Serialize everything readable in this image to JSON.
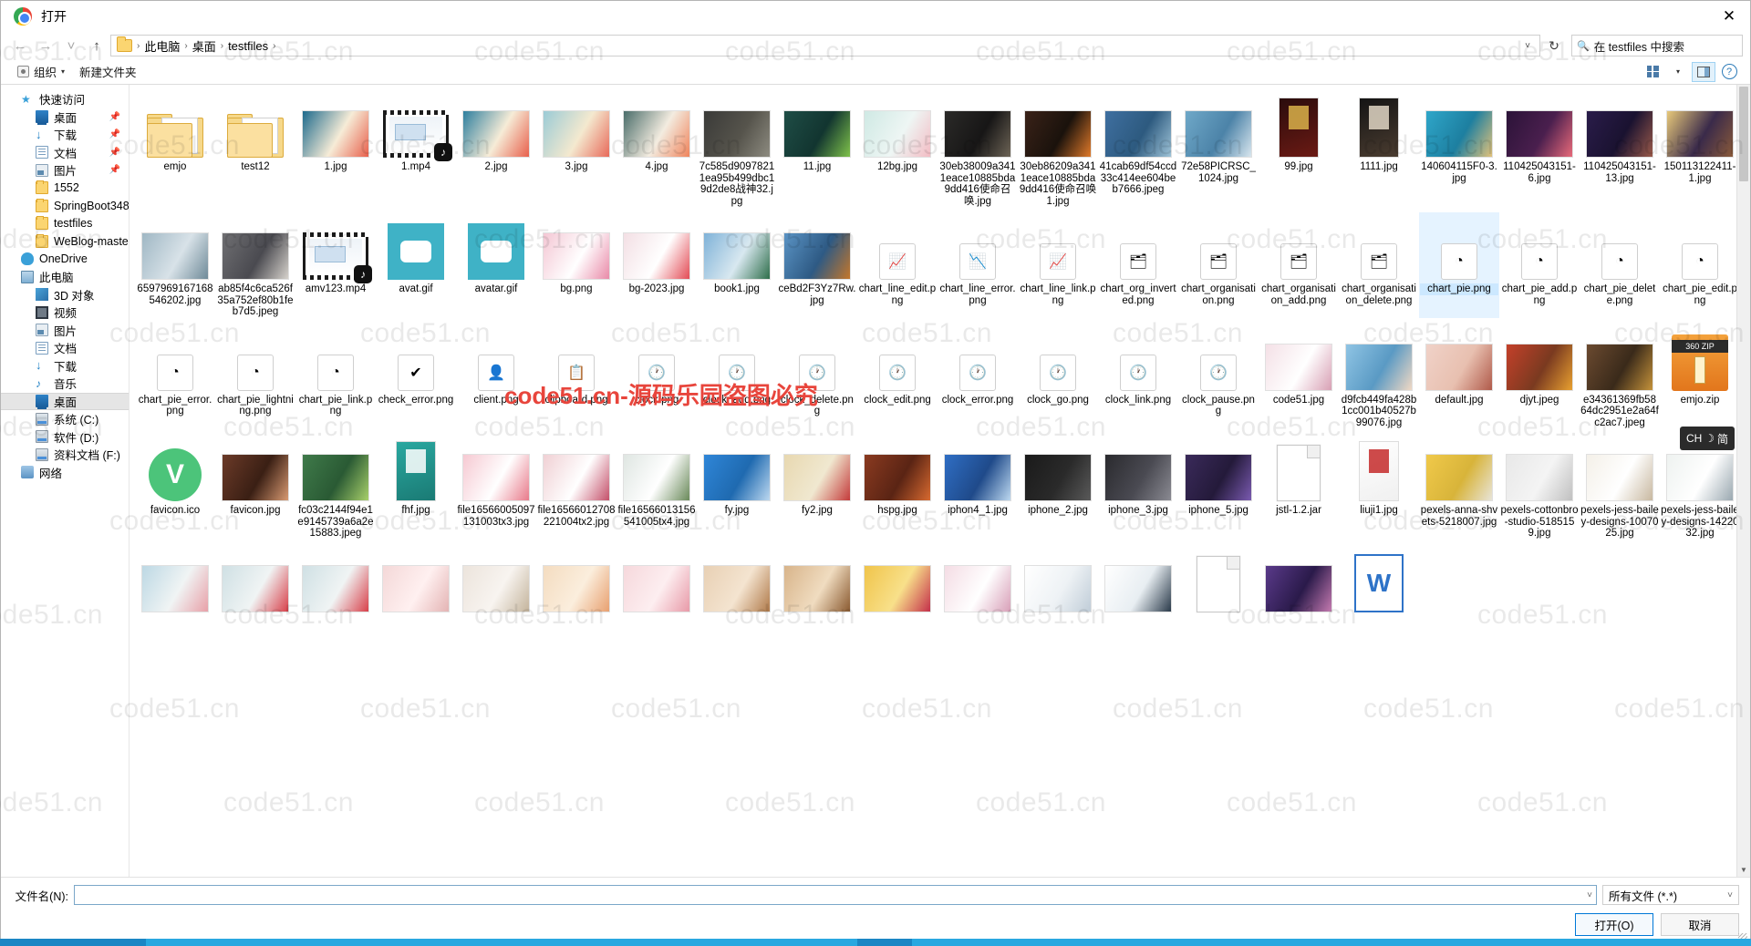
{
  "window": {
    "title": "打开",
    "close_label": "✕",
    "app_icon": "chrome-icon"
  },
  "address": {
    "back": "←",
    "forward": "→",
    "recent": "˅",
    "up": "↑",
    "crumbs": [
      "此电脑",
      "桌面",
      "testfiles"
    ],
    "separator": "›",
    "dropdown_caret": "˅",
    "refresh": "↻",
    "search_icon": "search-icon",
    "search_value": "在 testfiles 中搜索"
  },
  "commandbar": {
    "organize": "组织",
    "organize_caret": "▾",
    "new_folder": "新建文件夹",
    "view_icon": "view-layout-icon",
    "view_caret": "▾",
    "pane_icon": "preview-pane-icon",
    "help": "?"
  },
  "sidebar": {
    "items": [
      {
        "label": "快速访问",
        "icon": "star-icon",
        "level": 0,
        "pinned": false,
        "selected": false
      },
      {
        "label": "桌面",
        "icon": "desktop-icon",
        "level": 1,
        "pinned": true,
        "selected": false
      },
      {
        "label": "下载",
        "icon": "download-icon",
        "level": 1,
        "pinned": true,
        "selected": false
      },
      {
        "label": "文档",
        "icon": "documents-icon",
        "level": 1,
        "pinned": true,
        "selected": false
      },
      {
        "label": "图片",
        "icon": "pictures-icon",
        "level": 1,
        "pinned": true,
        "selected": false
      },
      {
        "label": "1552",
        "icon": "folder-icon",
        "level": 1,
        "pinned": false,
        "selected": false
      },
      {
        "label": "SpringBoot348",
        "icon": "folder-icon",
        "level": 1,
        "pinned": false,
        "selected": false
      },
      {
        "label": "testfiles",
        "icon": "folder-icon",
        "level": 1,
        "pinned": false,
        "selected": false
      },
      {
        "label": "WeBlog-master",
        "icon": "folder-icon",
        "level": 1,
        "pinned": false,
        "selected": false
      },
      {
        "label": "OneDrive",
        "icon": "cloud-icon",
        "level": 0,
        "pinned": false,
        "selected": false
      },
      {
        "label": "此电脑",
        "icon": "computer-icon",
        "level": 0,
        "pinned": false,
        "selected": false
      },
      {
        "label": "3D 对象",
        "icon": "3d-objects-icon",
        "level": 1,
        "pinned": false,
        "selected": false
      },
      {
        "label": "视频",
        "icon": "videos-icon",
        "level": 1,
        "pinned": false,
        "selected": false
      },
      {
        "label": "图片",
        "icon": "pictures-icon",
        "level": 1,
        "pinned": false,
        "selected": false
      },
      {
        "label": "文档",
        "icon": "documents-icon",
        "level": 1,
        "pinned": false,
        "selected": false
      },
      {
        "label": "下载",
        "icon": "download-icon",
        "level": 1,
        "pinned": false,
        "selected": false
      },
      {
        "label": "音乐",
        "icon": "music-icon",
        "level": 1,
        "pinned": false,
        "selected": false
      },
      {
        "label": "桌面",
        "icon": "desktop-icon",
        "level": 1,
        "pinned": false,
        "selected": true
      },
      {
        "label": "系统 (C:)",
        "icon": "drive-icon",
        "level": 1,
        "pinned": false,
        "selected": false
      },
      {
        "label": "软件 (D:)",
        "icon": "drive-icon",
        "level": 1,
        "pinned": false,
        "selected": false
      },
      {
        "label": "资料文档 (F:)",
        "icon": "drive-icon",
        "level": 1,
        "pinned": false,
        "selected": false
      },
      {
        "label": "网络",
        "icon": "network-icon",
        "level": 0,
        "pinned": false,
        "selected": false
      }
    ]
  },
  "files": [
    {
      "name": "emjo",
      "kind": "folder"
    },
    {
      "name": "test12",
      "kind": "folder"
    },
    {
      "name": "1.jpg",
      "kind": "image",
      "c1": "#1d6a8c",
      "c2": "#e8604c",
      "c3": "#f6ecd7"
    },
    {
      "name": "1.mp4",
      "kind": "video"
    },
    {
      "name": "2.jpg",
      "kind": "image",
      "c1": "#2e7f9e",
      "c2": "#e8604c",
      "c3": "#f6ecd7"
    },
    {
      "name": "3.jpg",
      "kind": "image",
      "c1": "#9bcbd6",
      "c2": "#e86a5a",
      "c3": "#f4e9cf"
    },
    {
      "name": "4.jpg",
      "kind": "image",
      "c1": "#4a6d6a",
      "c2": "#f0845c",
      "c3": "#f3ece0"
    },
    {
      "name": "7c585d90978211ea95b499dbc19d2de8战神32.jpg",
      "kind": "photo",
      "c1": "#3a3a38",
      "c2": "#8d8b80",
      "c3": "#56544c"
    },
    {
      "name": "11.jpg",
      "kind": "photo",
      "c1": "#1f4d46",
      "c2": "#7fc24a",
      "c3": "#123530"
    },
    {
      "name": "12bg.jpg",
      "kind": "image",
      "c1": "#cfe9e4",
      "c2": "#f3bcc4",
      "c3": "#eef6f4"
    },
    {
      "name": "30eb38009a3411eace10885bda9dd416使命召唤.jpg",
      "kind": "photo",
      "c1": "#2b2a28",
      "c2": "#6d6456",
      "c3": "#171616"
    },
    {
      "name": "30eb86209a3411eace10885bda9dd416使命召唤1.jpg",
      "kind": "photo",
      "c1": "#3a2218",
      "c2": "#e07a2a",
      "c3": "#1a120c"
    },
    {
      "name": "41cab69df54ccd33c414ee604beb7666.jpeg",
      "kind": "photo",
      "c1": "#3f6fa0",
      "c2": "#9fc4d8",
      "c3": "#2d5a7f"
    },
    {
      "name": "72e58PICRSC_1024.jpg",
      "kind": "photo",
      "c1": "#6fa8c8",
      "c2": "#d8e6ee",
      "c3": "#4c83a8"
    },
    {
      "name": "99.jpg",
      "kind": "poster",
      "c1": "#2a0c0c",
      "c2": "#d9b24a",
      "c3": "#6b1a14"
    },
    {
      "name": "1111.jpg",
      "kind": "poster",
      "c1": "#141414",
      "c2": "#e0d6c4",
      "c3": "#4a3c30"
    },
    {
      "name": "140604115F0-3.jpg",
      "kind": "photo",
      "c1": "#2fa6c9",
      "c2": "#e2c27a",
      "c3": "#1d7fa0"
    },
    {
      "name": "110425043151-6.jpg",
      "kind": "photo",
      "c1": "#2b1338",
      "c2": "#e86a7a",
      "c3": "#4a1f4e"
    },
    {
      "name": "110425043151-13.jpg",
      "kind": "photo",
      "c1": "#2a1c4a",
      "c2": "#9a5a4a",
      "c3": "#1a1230"
    },
    {
      "name": "150113122411-1.jpg",
      "kind": "photo",
      "c1": "#e8c97a",
      "c2": "#8a5a3a",
      "c3": "#3a2a4a"
    },
    {
      "name": "6597969167168546202.jpg",
      "kind": "photo",
      "c1": "#9fb7c4",
      "c2": "#6f8a98",
      "c3": "#d8e2e8"
    },
    {
      "name": "ab85f4c6ca526f35a752ef80b1feb7d5.jpeg",
      "kind": "photo",
      "c1": "#6f6f72",
      "c2": "#d6d2cc",
      "c3": "#4a4a50"
    },
    {
      "name": "amv123.mp4",
      "kind": "video"
    },
    {
      "name": "avat.gif",
      "kind": "avatar",
      "c1": "#3fb2c6",
      "c2": "#ffffff",
      "c3": "#2a8fa0"
    },
    {
      "name": "avatar.gif",
      "kind": "avatar",
      "c1": "#3fb2c6",
      "c2": "#ffffff",
      "c3": "#2a8fa0"
    },
    {
      "name": "bg.png",
      "kind": "image",
      "c1": "#f4c7d4",
      "c2": "#e98aa8",
      "c3": "#ffffff"
    },
    {
      "name": "bg-2023.jpg",
      "kind": "image",
      "c1": "#f3dfe4",
      "c2": "#e34b55",
      "c3": "#ffffff"
    },
    {
      "name": "book1.jpg",
      "kind": "photo",
      "c1": "#7fb2d8",
      "c2": "#2e6e4a",
      "c3": "#d8e8f0"
    },
    {
      "name": "ceBd2F3Yz7Rw.jpg",
      "kind": "photo",
      "c1": "#5a93c4",
      "c2": "#c4762a",
      "c3": "#2e5a84"
    },
    {
      "name": "chart_line_edit.png",
      "kind": "pngicon",
      "glyph": "📈"
    },
    {
      "name": "chart_line_error.png",
      "kind": "pngicon",
      "glyph": "📉"
    },
    {
      "name": "chart_line_link.png",
      "kind": "pngicon",
      "glyph": "📈"
    },
    {
      "name": "chart_org_inverted.png",
      "kind": "pngicon",
      "glyph": "🗂"
    },
    {
      "name": "chart_organisation.png",
      "kind": "pngicon",
      "glyph": "🗂"
    },
    {
      "name": "chart_organisation_add.png",
      "kind": "pngicon",
      "glyph": "🗂"
    },
    {
      "name": "chart_organisation_delete.png",
      "kind": "pngicon",
      "glyph": "🗂"
    },
    {
      "name": "chart_pie.png",
      "kind": "pngicon",
      "glyph": "◔",
      "selected": true
    },
    {
      "name": "chart_pie_add.png",
      "kind": "pngicon",
      "glyph": "◔"
    },
    {
      "name": "chart_pie_delete.png",
      "kind": "pngicon",
      "glyph": "◔"
    },
    {
      "name": "chart_pie_edit.png",
      "kind": "pngicon",
      "glyph": "◔"
    },
    {
      "name": "chart_pie_error.png",
      "kind": "pngicon",
      "glyph": "◔"
    },
    {
      "name": "chart_pie_lightning.png",
      "kind": "pngicon",
      "glyph": "◔"
    },
    {
      "name": "chart_pie_link.png",
      "kind": "pngicon",
      "glyph": "◔"
    },
    {
      "name": "check_error.png",
      "kind": "pngicon",
      "glyph": "✔"
    },
    {
      "name": "client.png",
      "kind": "pngicon",
      "glyph": "👤"
    },
    {
      "name": "clipboard.png",
      "kind": "pngicon",
      "glyph": "📋"
    },
    {
      "name": "clock.png",
      "kind": "pngicon",
      "glyph": "🕐"
    },
    {
      "name": "clock_add.png",
      "kind": "pngicon",
      "glyph": "🕐"
    },
    {
      "name": "clock_delete.png",
      "kind": "pngicon",
      "glyph": "🕐"
    },
    {
      "name": "clock_edit.png",
      "kind": "pngicon",
      "glyph": "🕐"
    },
    {
      "name": "clock_error.png",
      "kind": "pngicon",
      "glyph": "🕐"
    },
    {
      "name": "clock_go.png",
      "kind": "pngicon",
      "glyph": "🕐"
    },
    {
      "name": "clock_link.png",
      "kind": "pngicon",
      "glyph": "🕐"
    },
    {
      "name": "clock_pause.png",
      "kind": "pngicon",
      "glyph": "🕐"
    },
    {
      "name": "code51.jpg",
      "kind": "photo",
      "c1": "#f4e0e6",
      "c2": "#d8a0b4",
      "c3": "#ffffff"
    },
    {
      "name": "d9fcb449fa428b1cc001b40527b99076.jpg",
      "kind": "photo",
      "c1": "#8fc4e4",
      "c2": "#f0d8c4",
      "c3": "#5a9ac4"
    },
    {
      "name": "default.jpg",
      "kind": "photo",
      "c1": "#f0d2c8",
      "c2": "#b05a4a",
      "c3": "#e8c0b0"
    },
    {
      "name": "djyt.jpeg",
      "kind": "photo",
      "c1": "#c4402a",
      "c2": "#e8a030",
      "c3": "#7a3a20"
    },
    {
      "name": "e34361369fb5864dc2951e2a64fc2ac7.jpeg",
      "kind": "photo",
      "c1": "#6b4a30",
      "c2": "#c4923a",
      "c3": "#3a2a1a"
    },
    {
      "name": "emjo.zip",
      "kind": "zip"
    },
    {
      "name": "favicon.ico",
      "kind": "favicon"
    },
    {
      "name": "favicon.jpg",
      "kind": "photo",
      "c1": "#6b3a28",
      "c2": "#d89a72",
      "c3": "#3a1f14"
    },
    {
      "name": "fc03c2144f94e1e9145739a6a2e15883.jpeg",
      "kind": "photo",
      "c1": "#3f7a4a",
      "c2": "#a8d06a",
      "c3": "#2a5a34"
    },
    {
      "name": "fhf.jpg",
      "kind": "poster",
      "c1": "#2aa8a0",
      "c2": "#ffffff",
      "c3": "#1a7a74"
    },
    {
      "name": "file16566005097131003tx3.jpg",
      "kind": "photo",
      "c1": "#f6c9d2",
      "c2": "#e87a8a",
      "c3": "#ffffff"
    },
    {
      "name": "file16566012708221004tx2.jpg",
      "kind": "photo",
      "c1": "#f0d0d4",
      "c2": "#c4506a",
      "c3": "#ffffff"
    },
    {
      "name": "file16566013156541005tx4.jpg",
      "kind": "photo",
      "c1": "#dfe6e2",
      "c2": "#6a8a5a",
      "c3": "#ffffff"
    },
    {
      "name": "fy.jpg",
      "kind": "photo",
      "c1": "#2f86d8",
      "c2": "#bcd8f0",
      "c3": "#1f6ab0"
    },
    {
      "name": "fy2.jpg",
      "kind": "photo",
      "c1": "#e8d8b0",
      "c2": "#c43a3a",
      "c3": "#f0e8d0"
    },
    {
      "name": "hspg.jpg",
      "kind": "photo",
      "c1": "#8a3a20",
      "c2": "#d86a30",
      "c3": "#5a2414"
    },
    {
      "name": "iphon4_1.jpg",
      "kind": "photo",
      "c1": "#2f6ec4",
      "c2": "#bcd8f0",
      "c3": "#1f4a8a"
    },
    {
      "name": "iphone_2.jpg",
      "kind": "photo",
      "c1": "#1a1a1a",
      "c2": "#5a5a5a",
      "c3": "#2a2a2a"
    },
    {
      "name": "iphone_3.jpg",
      "kind": "photo",
      "c1": "#2a2a2e",
      "c2": "#8a8a92",
      "c3": "#4a4a52"
    },
    {
      "name": "iphone_5.jpg",
      "kind": "photo",
      "c1": "#3a2a5a",
      "c2": "#7a5ab0",
      "c3": "#241a3a"
    },
    {
      "name": "jstl-1.2.jar",
      "kind": "doc"
    },
    {
      "name": "liuji1.jpg",
      "kind": "poster",
      "c1": "#ffffff",
      "c2": "#c42a2a",
      "c3": "#f0f0f0"
    },
    {
      "name": "pexels-anna-shvets-5218007.jpg",
      "kind": "photo",
      "c1": "#f0c94a",
      "c2": "#e8e4d8",
      "c3": "#d8b43a"
    },
    {
      "name": "pexels-cottonbro-studio-5185159.jpg",
      "kind": "photo",
      "c1": "#e8e8e8",
      "c2": "#c0c0c0",
      "c3": "#f4f4f4"
    },
    {
      "name": "pexels-jess-bailey-designs-1007025.jpg",
      "kind": "photo",
      "c1": "#f4f0e8",
      "c2": "#c8b8a0",
      "c3": "#ffffff"
    },
    {
      "name": "pexels-jess-bailey-designs-1422032.jpg",
      "kind": "photo",
      "c1": "#eef2f0",
      "c2": "#9aa8b0",
      "c3": "#ffffff"
    },
    {
      "name": "",
      "kind": "photo",
      "c1": "#bcd8e4",
      "c2": "#e8a0a8",
      "c3": "#f0f4f4"
    },
    {
      "name": "",
      "kind": "photo",
      "c1": "#cfe0e4",
      "c2": "#d8404a",
      "c3": "#f0f4f4"
    },
    {
      "name": "",
      "kind": "photo",
      "c1": "#cfe0e4",
      "c2": "#d8404a",
      "c3": "#f0f4f4"
    },
    {
      "name": "",
      "kind": "photo",
      "c1": "#f4d8d8",
      "c2": "#e4b4b4",
      "c3": "#fff0f0"
    },
    {
      "name": "",
      "kind": "photo",
      "c1": "#ece4dc",
      "c2": "#c4b49c",
      "c3": "#f8f4f0"
    },
    {
      "name": "",
      "kind": "photo",
      "c1": "#f4dcc0",
      "c2": "#e8a070",
      "c3": "#fbeedd"
    },
    {
      "name": "",
      "kind": "photo",
      "c1": "#f6d8dc",
      "c2": "#e89aa8",
      "c3": "#fdeef0"
    },
    {
      "name": "",
      "kind": "photo",
      "c1": "#e8d0b4",
      "c2": "#b07a4a",
      "c3": "#f4e4d0"
    },
    {
      "name": "",
      "kind": "photo",
      "c1": "#d8b48a",
      "c2": "#8a5a30",
      "c3": "#f0dcc0"
    },
    {
      "name": "",
      "kind": "photo",
      "c1": "#f0c44a",
      "c2": "#c4304a",
      "c3": "#f8e08a"
    },
    {
      "name": "",
      "kind": "photo",
      "c1": "#f4dce4",
      "c2": "#d8a0b8",
      "c3": "#ffffff"
    },
    {
      "name": "",
      "kind": "photo",
      "c1": "#ffffff",
      "c2": "#c0cdd8",
      "c3": "#eef2f5"
    },
    {
      "name": "",
      "kind": "photo",
      "c1": "#ffffff",
      "c2": "#2a3a4a",
      "c3": "#e8eef2"
    },
    {
      "name": "",
      "kind": "doc"
    },
    {
      "name": "",
      "kind": "photo",
      "c1": "#5a3a8a",
      "c2": "#c47ab0",
      "c3": "#2a1a4a"
    },
    {
      "name": "",
      "kind": "wps"
    }
  ],
  "scrollbar": {
    "up_arrow": "▲",
    "down_arrow": "▼"
  },
  "footer": {
    "filename_label": "文件名(N):",
    "filename_value": "",
    "filename_caret": "˅",
    "filter_value": "所有文件 (*.*)",
    "filter_caret": "˅",
    "open_button": "打开(O)",
    "cancel_button": "取消"
  },
  "ime": {
    "lang": "CH",
    "mode": "简",
    "moon": "☽"
  },
  "watermarks": {
    "text": "code51.cn",
    "red_text": "code51.cn-源码乐园盗图必究",
    "color": "#e8453c"
  }
}
